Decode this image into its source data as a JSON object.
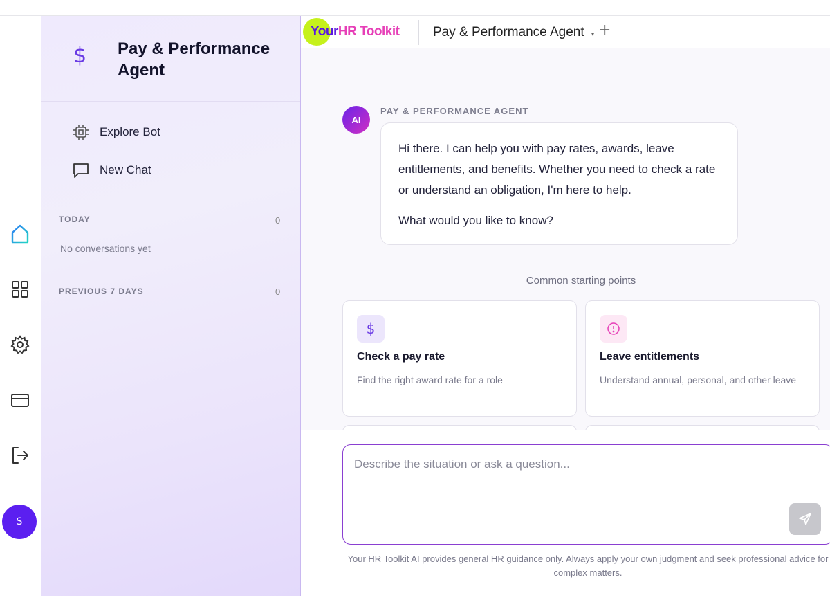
{
  "brand": {
    "part1": "Your",
    "part2": "HR Toolkit"
  },
  "topbar": {
    "title": "Pay & Performance Agent",
    "caret": "▾",
    "plus": "+"
  },
  "user": {
    "initial": "S"
  },
  "sidebar": {
    "title": "Pay & Performance Agent",
    "icon": "$",
    "menu": [
      {
        "label": "Explore Bot",
        "icon": "chip-icon"
      },
      {
        "label": "New Chat",
        "icon": "chat-icon"
      }
    ],
    "sections": [
      {
        "label": "TODAY",
        "count": "0",
        "empty": "No conversations yet"
      },
      {
        "label": "PREVIOUS 7 DAYS",
        "count": "0"
      }
    ]
  },
  "chat": {
    "badge": "AI",
    "agent_label": "PAY & PERFORMANCE AGENT",
    "message": {
      "p1": "Hi there. I can help you with pay rates, awards, leave entitlements, and benefits. Whether you need to check a rate or understand an obligation, I'm here to help.",
      "p2": "What would you like to know?"
    },
    "starting_label": "Common starting points",
    "cards": [
      {
        "title": "Check a pay rate",
        "desc": "Find the right award rate for a role",
        "icon": "dollar-icon",
        "icon_color": "#6a3be4",
        "icon_bg": "#ece6fc"
      },
      {
        "title": "Leave entitlements",
        "desc": "Understand annual, personal, and other leave",
        "icon": "alert-circle-icon",
        "icon_color": "#e63fb7",
        "icon_bg": "#fde8f5"
      }
    ]
  },
  "composer": {
    "placeholder": "Describe the situation or ask a question...",
    "disclaimer": "Your HR Toolkit AI provides general HR guidance only. Always apply your own judgment and seek professional advice for complex matters."
  },
  "colors": {
    "accent": "#5b1ff0",
    "brand_pink": "#e63fb7",
    "brand_lime": "#c6f11c"
  }
}
